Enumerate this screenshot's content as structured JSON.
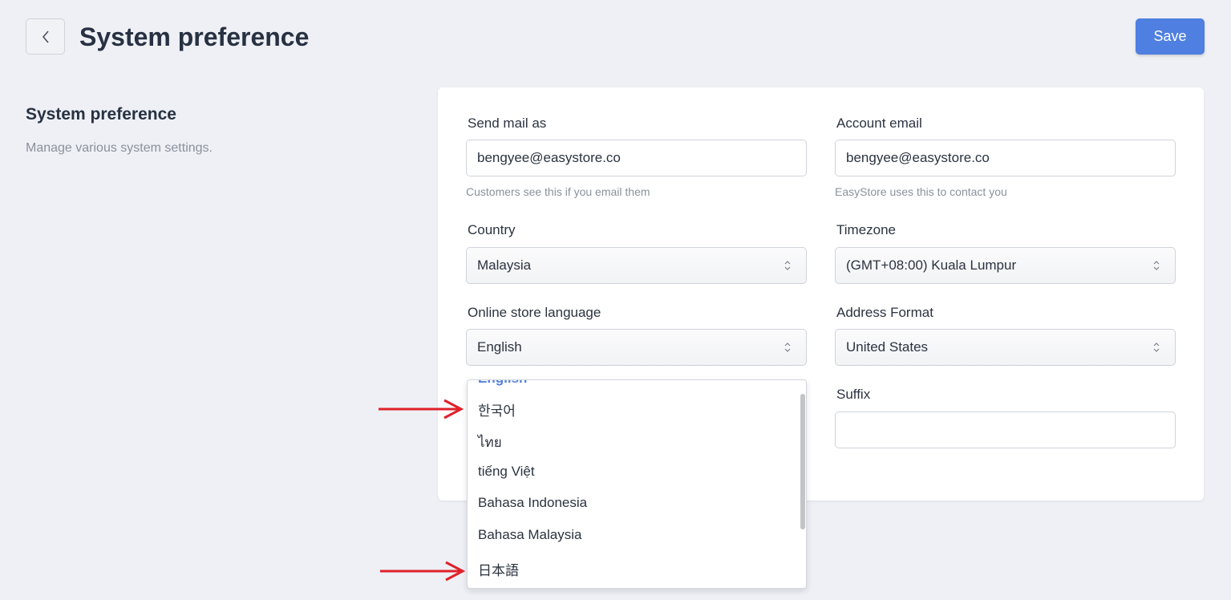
{
  "header": {
    "title": "System preference",
    "save_label": "Save"
  },
  "section": {
    "title": "System preference",
    "description": "Manage various system settings."
  },
  "form": {
    "send_mail_as": {
      "label": "Send mail as",
      "value": "bengyee@easystore.co",
      "help": "Customers see this if you email them"
    },
    "account_email": {
      "label": "Account email",
      "value": "bengyee@easystore.co",
      "help": "EasyStore uses this to contact you"
    },
    "country": {
      "label": "Country",
      "value": "Malaysia"
    },
    "timezone": {
      "label": "Timezone",
      "value": "(GMT+08:00) Kuala Lumpur"
    },
    "store_language": {
      "label": "Online store language",
      "value": "English"
    },
    "address_format": {
      "label": "Address Format",
      "value": "United States"
    },
    "suffix": {
      "label": "Suffix",
      "value": ""
    }
  },
  "language_dropdown": {
    "selected": "English",
    "options": [
      "한국어",
      "ไทย",
      "tiếng Việt",
      "Bahasa Indonesia",
      "Bahasa Malaysia",
      "日本語"
    ]
  },
  "colors": {
    "accent": "#4f7fe0",
    "annotation_arrow": "#e0212b",
    "background": "#eef0f5"
  }
}
